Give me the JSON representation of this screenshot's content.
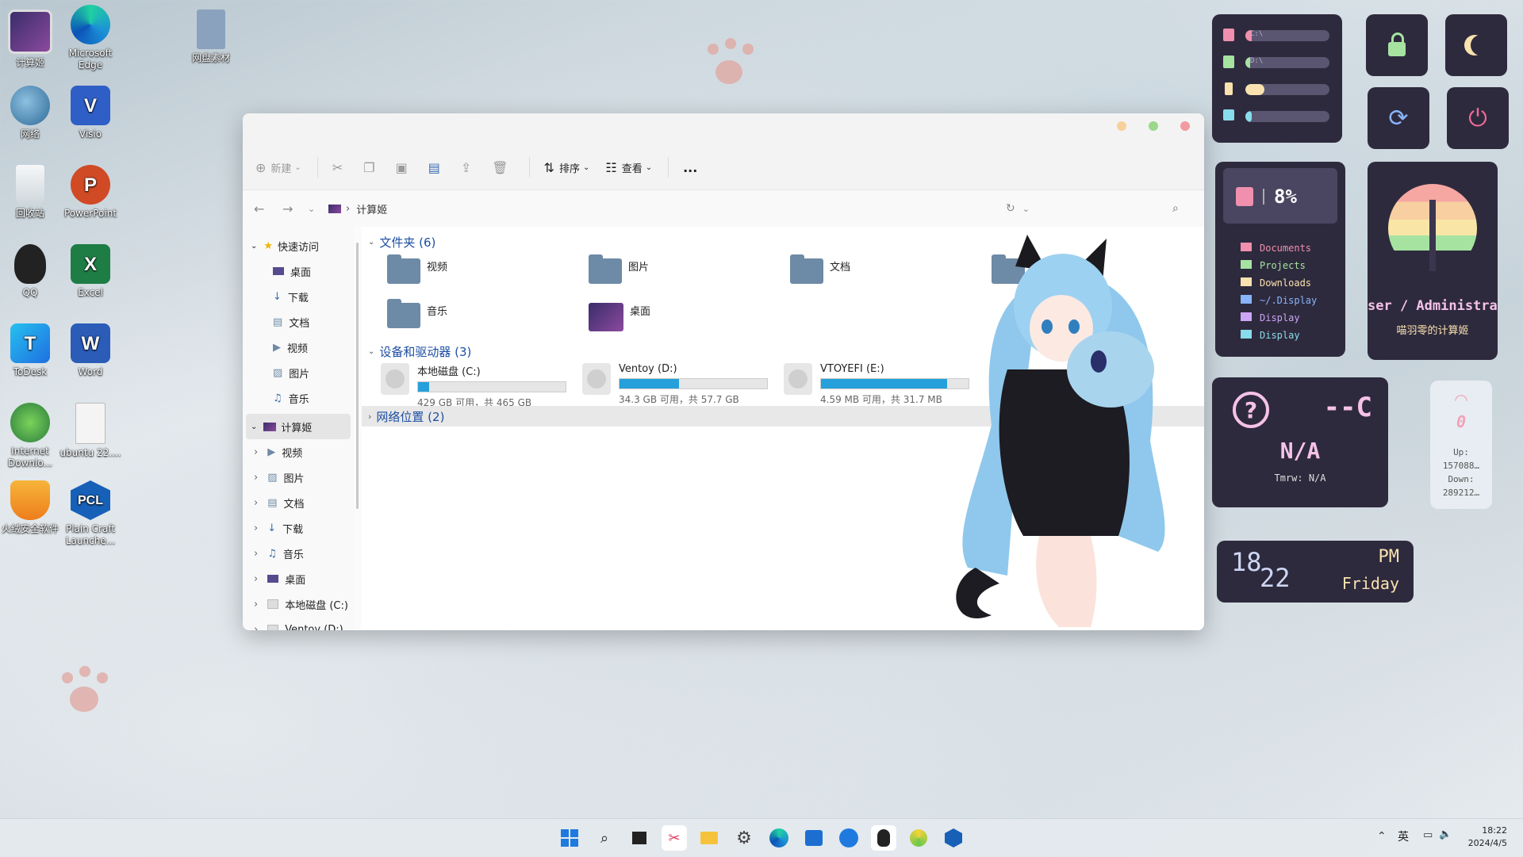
{
  "desktop": {
    "icons": [
      {
        "label": "计算姬",
        "icon": "monitor-icon",
        "color": "#5b3f8f"
      },
      {
        "label": "Microsoft Edge",
        "icon": "edge-icon",
        "color": "#1c8fd6"
      },
      {
        "label": "网盘素材",
        "icon": "file-icon",
        "color": "#7d98b5"
      },
      {
        "label": "网络",
        "icon": "globe-icon",
        "color": "#3c7aa8"
      },
      {
        "label": "Visio",
        "icon": "visio-icon",
        "color": "#2f5fc6"
      },
      {
        "label": "回收站",
        "icon": "recycle-bin-icon",
        "color": "#e8eef2"
      },
      {
        "label": "PowerPoint",
        "icon": "powerpoint-icon",
        "color": "#d04a25"
      },
      {
        "label": "QQ",
        "icon": "qq-icon",
        "color": "#222"
      },
      {
        "label": "Excel",
        "icon": "excel-icon",
        "color": "#1e7d45"
      },
      {
        "label": "ToDesk",
        "icon": "todesk-icon",
        "color": "#2b8cef"
      },
      {
        "label": "Word",
        "icon": "word-icon",
        "color": "#2b5cb8"
      },
      {
        "label": "Internet Downlo...",
        "icon": "idm-icon",
        "color": "#2b7c3d"
      },
      {
        "label": "ubuntu 22....",
        "icon": "disc-file-icon",
        "color": "#f2f2f2"
      },
      {
        "label": "火绒安全软件",
        "icon": "huorong-icon",
        "color": "#f29b1f"
      },
      {
        "label": "Plain Craft Launche...",
        "icon": "pcl-icon",
        "color": "#1760b8"
      }
    ]
  },
  "explorer": {
    "toolbar": {
      "new": "新建",
      "sort": "排序",
      "view": "查看",
      "more": "..."
    },
    "address": {
      "location": "计算姬"
    },
    "nav": {
      "quick_access": "快速访问",
      "quick_items": [
        "桌面",
        "下载",
        "文档",
        "视频",
        "图片",
        "音乐"
      ],
      "computer": "计算姬",
      "computer_items": [
        "视频",
        "图片",
        "文档",
        "下载",
        "音乐",
        "桌面",
        "本地磁盘 (C:)",
        "Ventoy (D:)"
      ]
    },
    "folders_header": "文件夹 (6)",
    "folders": [
      "视频",
      "图片",
      "文档",
      "下载",
      "音乐",
      "桌面"
    ],
    "drives_header": "设备和驱动器 (3)",
    "drives": [
      {
        "name": "本地磁盘 (C:)",
        "info": "429 GB 可用，共 465 GB",
        "used": 0.077
      },
      {
        "name": "Ventoy (D:)",
        "info": "34.3 GB 可用，共 57.7 GB",
        "used": 0.405
      },
      {
        "name": "VTOYEFI (E:)",
        "info": "4.59 MB 可用，共 31.7 MB",
        "used": 0.855
      }
    ],
    "network_header": "网络位置 (2)"
  },
  "widgets": {
    "drives": [
      {
        "label": "C:\\",
        "fill": 0.08
      },
      {
        "label": "D:\\",
        "fill": 0.0
      }
    ],
    "ram_fill": 0.23,
    "cpu_fill": 0.08,
    "disk_percent": "8%",
    "shortcuts": [
      "Documents",
      "Projects",
      "Downloads",
      "~/.Display",
      "Display",
      "Display"
    ],
    "user": "ser / Administrator",
    "machine": "喵羽零的计算姬",
    "weather": {
      "icon": "?",
      "temp": "--C",
      "cond": "N/A",
      "tmrw": "Tmrw: N/A"
    },
    "network": {
      "count": "0",
      "up_label": "Up:",
      "up": "157088…",
      "down_label": "Down:",
      "down": "289212…"
    },
    "clock": {
      "hour": "18",
      "minute": "22",
      "ampm": "PM",
      "day": "Friday"
    }
  },
  "taskbar": {
    "tray": {
      "ime": "英",
      "time": "18:22",
      "date": "2024/4/5"
    }
  },
  "colors": {
    "accent": "#26a0da",
    "widget_bg": "#2e2a3d",
    "widget_pink": "#f06b9a"
  }
}
